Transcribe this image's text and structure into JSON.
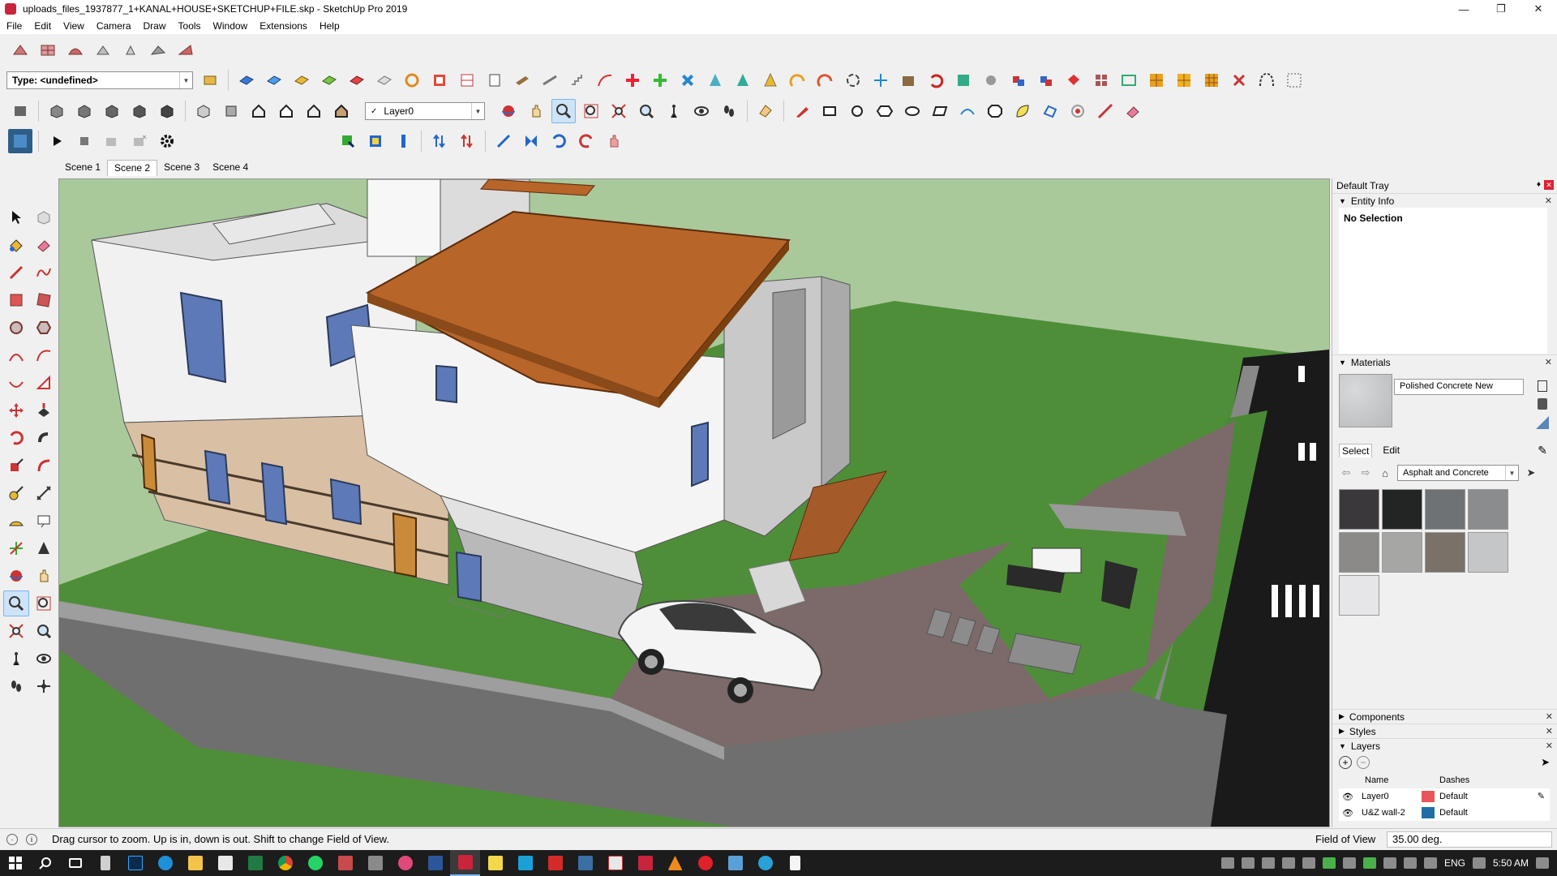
{
  "window": {
    "title": "uploads_files_1937877_1+KANAL+HOUSE+SKETCHUP+FILE.skp - SketchUp Pro 2019",
    "controls": [
      "minimize",
      "restore",
      "close"
    ]
  },
  "menu": [
    "File",
    "Edit",
    "View",
    "Camera",
    "Draw",
    "Tools",
    "Window",
    "Extensions",
    "Help"
  ],
  "toolbar": {
    "type_combo": "Type: <undefined>",
    "layer_combo": "Layer0",
    "layer_check": "✓"
  },
  "scenes": [
    {
      "label": "Scene 1",
      "active": false
    },
    {
      "label": "Scene 2",
      "active": true
    },
    {
      "label": "Scene 3",
      "active": false
    },
    {
      "label": "Scene 4",
      "active": false
    }
  ],
  "tray": {
    "title": "Default Tray",
    "entity_info": {
      "header": "Entity Info",
      "value": "No Selection"
    },
    "materials": {
      "header": "Materials",
      "current": "Polished Concrete New",
      "tab_select": "Select",
      "tab_edit": "Edit",
      "collection": "Asphalt and Concrete",
      "swatch_colors": [
        "#3b383b",
        "#232424",
        "#6f7274",
        "#8a8c8d",
        "#8c8a88",
        "#a6a7a5",
        "#7a7168",
        "#c4c6c8",
        "#e6e6e8"
      ]
    },
    "components": "Components",
    "styles": "Styles",
    "layers": {
      "header": "Layers",
      "col_name": "Name",
      "col_dashes": "Dashes",
      "rows": [
        {
          "name": "Layer0",
          "color": "#e8565b",
          "dashes": "Default"
        },
        {
          "name": "U&Z wall-2",
          "color": "#1f6fa6",
          "dashes": "Default"
        }
      ]
    }
  },
  "status": {
    "message": "Drag cursor to zoom.  Up is in, down is out. Shift to change Field of View.",
    "vcb_label": "Field of View",
    "vcb_value": "35.00 deg."
  },
  "taskbar": {
    "lang": "ENG",
    "time": "5:50 AM"
  },
  "colors": {
    "sky": "#a9c99b",
    "grass": "#4f8e39",
    "roof": "#b8652a",
    "paving": "#7b6a69",
    "wall_white": "#f1f1f1",
    "stone": "#d9c0a5"
  }
}
